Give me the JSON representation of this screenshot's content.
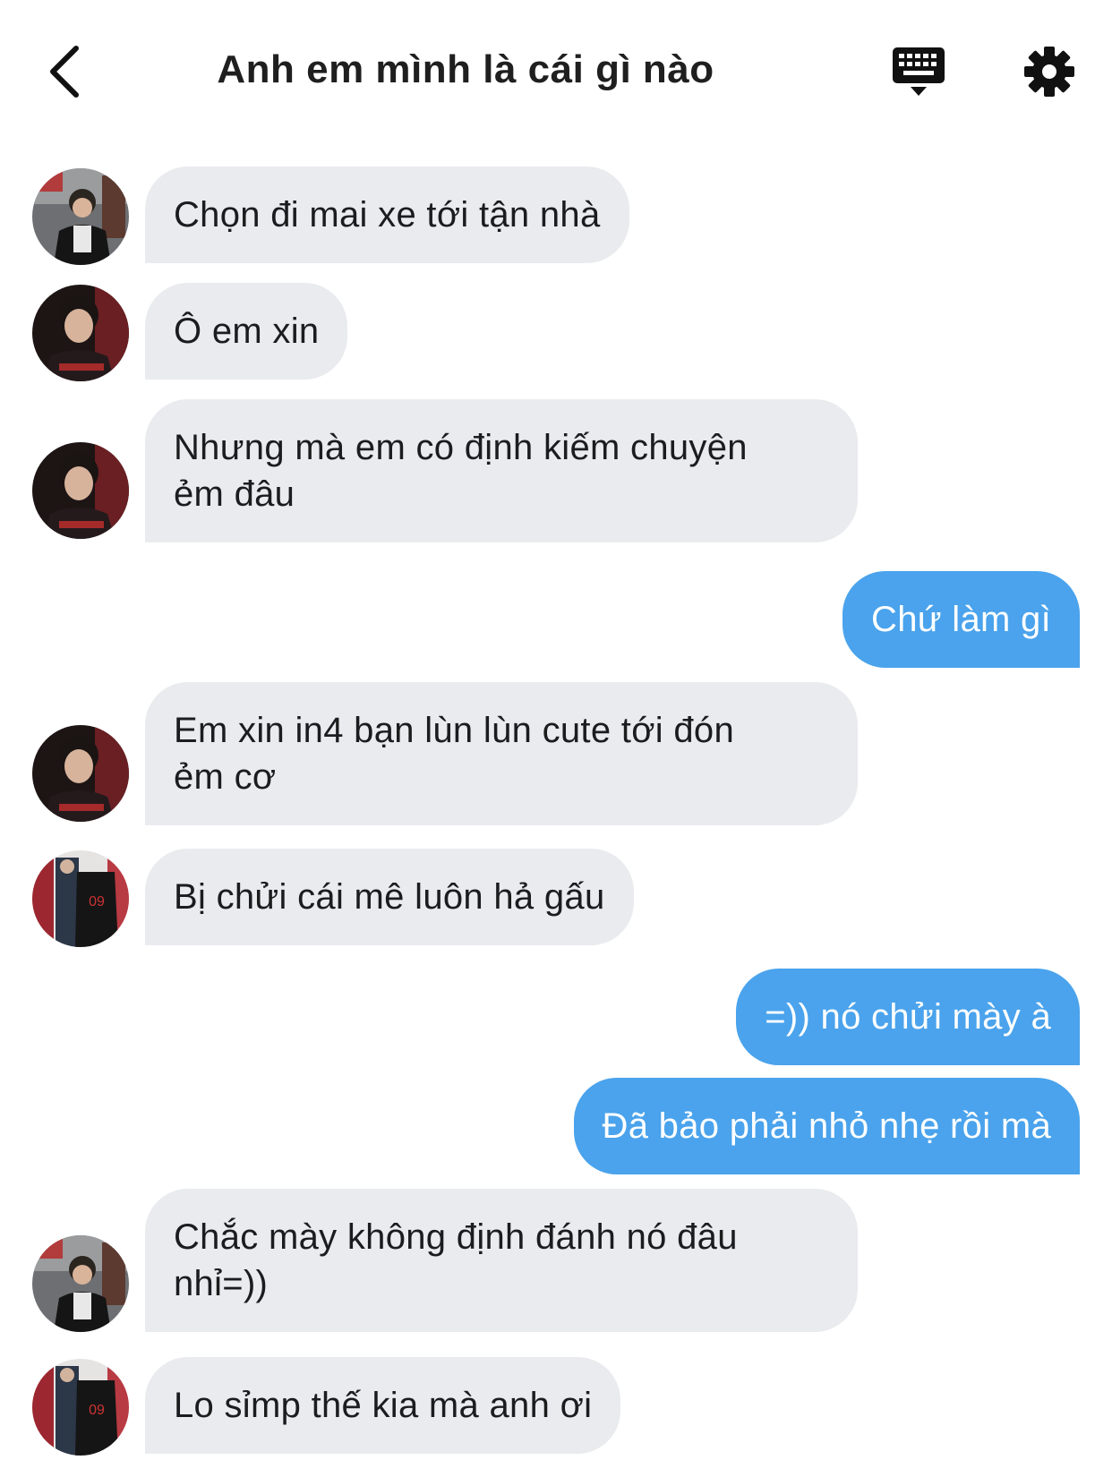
{
  "header": {
    "title": "Anh em mình là cái gì nào",
    "back_icon": "chevron-left-icon",
    "keyboard_icon": "keyboard-icon",
    "settings_icon": "gear-icon"
  },
  "messages": [
    {
      "direction": "in",
      "sender_avatar": "avatar-a",
      "text": "Chọn đi mai xe tới tận nhà"
    },
    {
      "direction": "in",
      "sender_avatar": "avatar-b",
      "text": " Ô em xin"
    },
    {
      "direction": "in",
      "sender_avatar": "avatar-b",
      "text": "Nhưng mà em có định kiếm chuyện\nẻm đâu"
    },
    {
      "direction": "out",
      "text": "Chứ làm gì"
    },
    {
      "direction": "in",
      "sender_avatar": "avatar-b",
      "text": "Em xin in4 bạn lùn lùn cute tới đón\nẻm cơ"
    },
    {
      "direction": "in",
      "sender_avatar": "avatar-c",
      "text": "Bị chửi cái mê luôn hả gấu"
    },
    {
      "direction": "out",
      "text": "=)) nó chửi mày à"
    },
    {
      "direction": "out",
      "text": "Đã bảo phải nhỏ nhẹ rồi mà"
    },
    {
      "direction": "in",
      "sender_avatar": "avatar-a",
      "text": "Chắc mày không định đánh nó đâu\nnhỉ=))"
    },
    {
      "direction": "in",
      "sender_avatar": "avatar-c",
      "text": "Lo sỉmp thế kia mà anh ơi"
    }
  ],
  "colors": {
    "incoming_bubble": "#e9ebee",
    "outgoing_bubble": "#4aa3ec",
    "outgoing_text": "#ffffff"
  }
}
